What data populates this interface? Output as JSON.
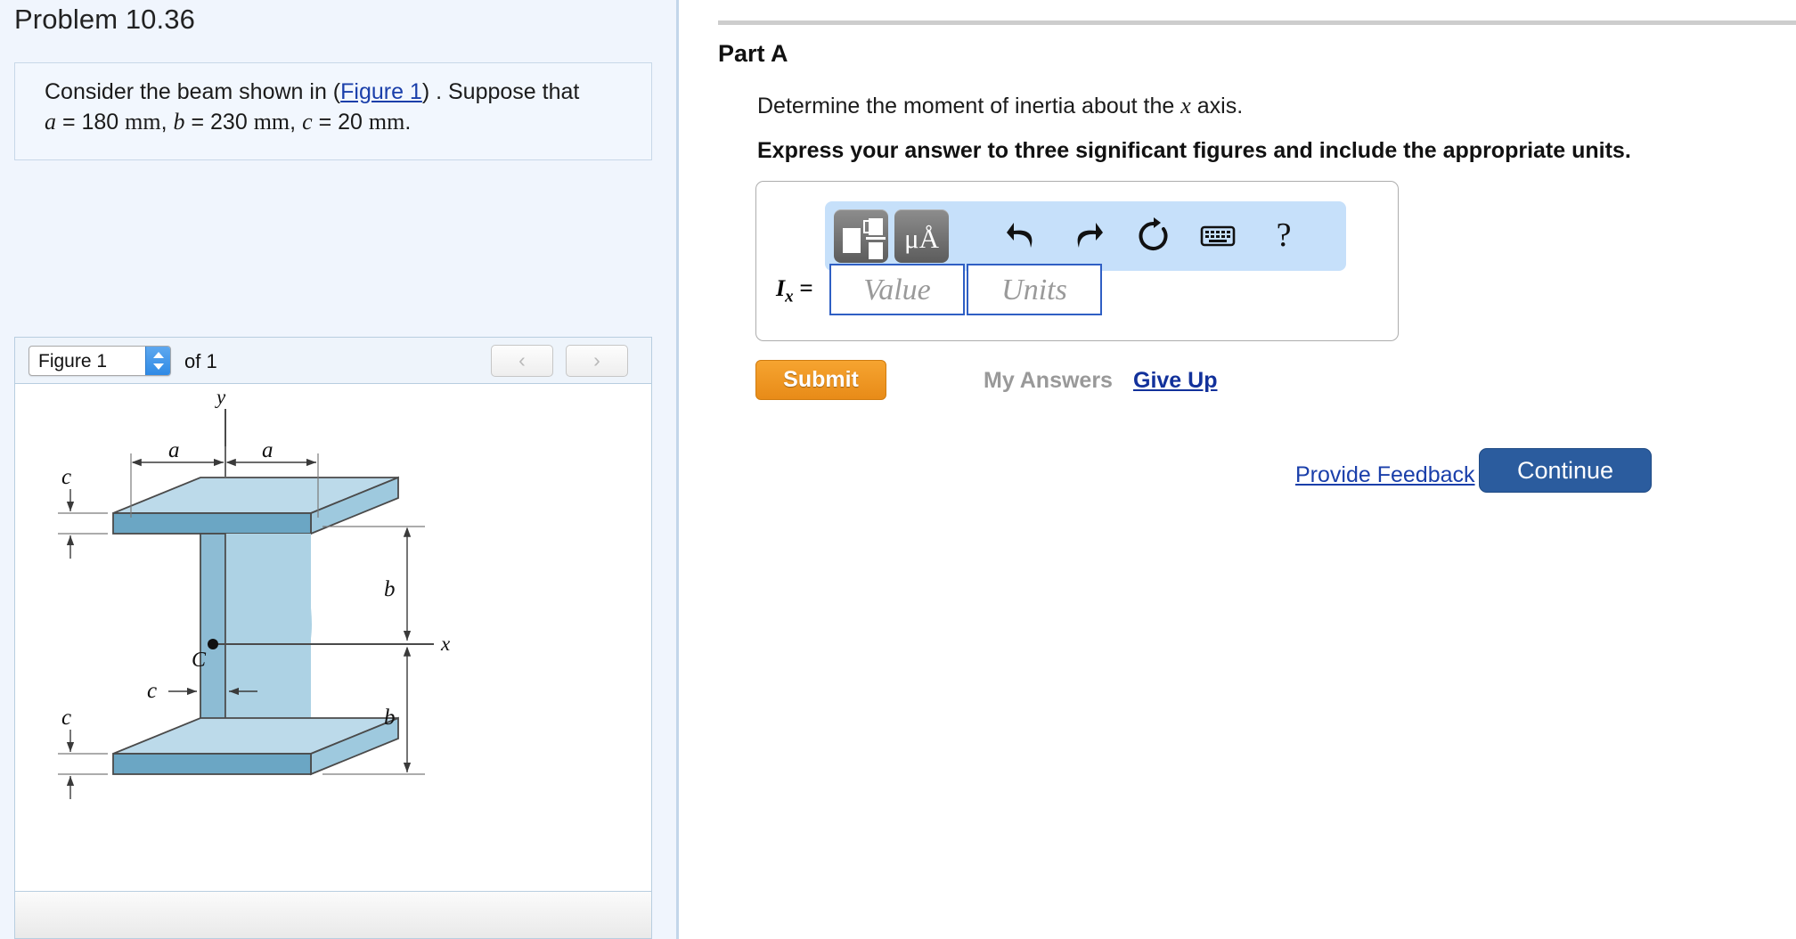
{
  "problem": {
    "title": "Problem 10.36",
    "statement_prefix": "Consider the beam shown in (",
    "figure_link": "Figure 1",
    "statement_suffix": ") . Suppose that",
    "given": {
      "a_sym": "a",
      "a_eq": "= 180",
      "a_unit": "mm",
      "sep1": ",",
      "b_sym": "b",
      "b_eq": "= 230",
      "b_unit": "mm",
      "sep2": ",",
      "c_sym": "c",
      "c_eq": "= 20",
      "c_unit": "mm",
      "period": "."
    }
  },
  "figure_nav": {
    "selected": "Figure 1",
    "count_label": "of 1",
    "prev_icon": "‹",
    "next_icon": "›",
    "stepper_icon": "chevron-up-down-icon"
  },
  "figure": {
    "caption_axes": {
      "y": "y",
      "x": "x",
      "centroid": "C"
    },
    "dimensions": {
      "a_left": "a",
      "a_right": "a",
      "c_top": "c",
      "c_bottom": "c",
      "c_web": "c",
      "b_upper": "b",
      "b_lower": "b"
    },
    "colors": {
      "top_face": "#b7d6e6",
      "front_face": "#6ba6c4",
      "web_face": "#a8cddf",
      "edge": "#4a4a4a"
    }
  },
  "part": {
    "label": "Part A",
    "question_pre": "Determine the moment of inertia about the ",
    "question_var": "x",
    "question_post": " axis.",
    "instruction": "Express your answer to three significant figures and include the appropriate units."
  },
  "answer": {
    "toolbar": {
      "template_button": "template-glyph",
      "units_button": "μÅ",
      "undo": "undo-arrow-icon",
      "redo": "redo-arrow-icon",
      "reset": "reset-circular-arrow-icon",
      "keyboard": "keyboard-icon",
      "help": "?"
    },
    "variable": "I",
    "subscript": "x",
    "equals": "=",
    "value_placeholder": "Value",
    "units_placeholder": "Units",
    "value_current": "",
    "units_current": ""
  },
  "actions": {
    "submit": "Submit",
    "my_answers": "My Answers",
    "give_up": "Give Up",
    "provide_feedback": "Provide Feedback",
    "continue": "Continue"
  },
  "colors": {
    "submit_orange": "#e88b18",
    "continue_blue": "#2b5c9e",
    "link_blue": "#1a3faa",
    "sidebar_bg": "#f0f5fd",
    "toolbar_bg": "#c6e0fa",
    "input_border": "#2f5fc4"
  }
}
